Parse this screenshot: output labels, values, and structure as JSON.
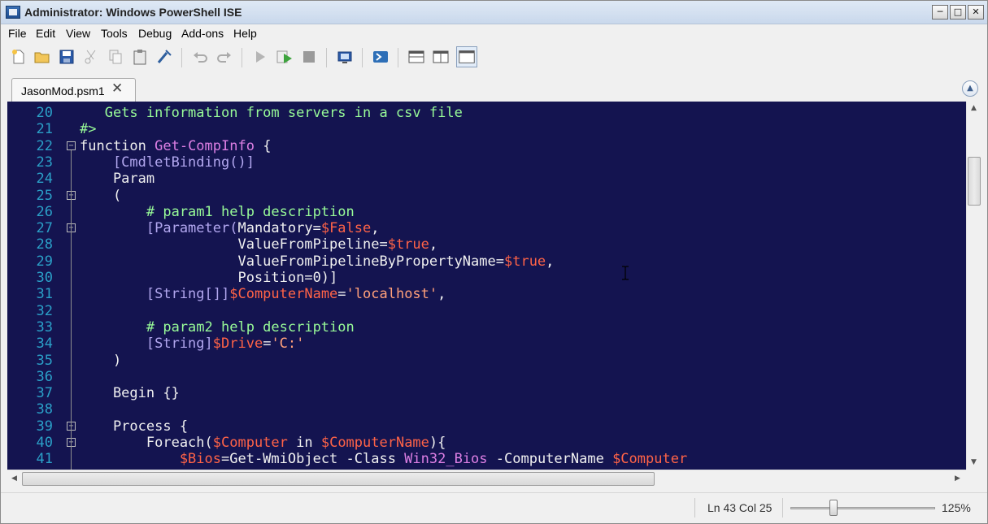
{
  "window": {
    "title": "Administrator: Windows PowerShell ISE"
  },
  "menu": [
    "File",
    "Edit",
    "View",
    "Tools",
    "Debug",
    "Add-ons",
    "Help"
  ],
  "toolbar": [
    "new-icon",
    "open-icon",
    "save-icon",
    "cut-icon",
    "copy-icon",
    "paste-icon",
    "clear-console-icon",
    "undo-icon",
    "redo-icon",
    "run-icon",
    "run-selection-icon",
    "stop-icon",
    "remote-powershell-icon",
    "powershell-icon",
    "show-script-top-icon",
    "show-script-right-icon",
    "show-script-maximized-icon"
  ],
  "tab": {
    "label": "JasonMod.psm1",
    "close": "✕"
  },
  "code_lines": [
    {
      "num": "20",
      "fold": "",
      "segs": [
        [
          "c-comment",
          "   Gets information from servers in a csv file"
        ]
      ]
    },
    {
      "num": "21",
      "fold": "",
      "segs": [
        [
          "c-comment",
          "#>"
        ]
      ]
    },
    {
      "num": "22",
      "fold": "⊟",
      "segs": [
        [
          "c-plain",
          "function "
        ],
        [
          "c-func",
          "Get-CompInfo"
        ],
        [
          "c-plain",
          " {"
        ]
      ]
    },
    {
      "num": "23",
      "fold": "",
      "segs": [
        [
          "c-type",
          "    [CmdletBinding()]"
        ]
      ]
    },
    {
      "num": "24",
      "fold": "",
      "segs": [
        [
          "c-plain",
          "    Param"
        ]
      ]
    },
    {
      "num": "25",
      "fold": "⊟",
      "segs": [
        [
          "c-plain",
          "    ("
        ]
      ]
    },
    {
      "num": "26",
      "fold": "",
      "segs": [
        [
          "c-comment",
          "        # param1 help description"
        ]
      ]
    },
    {
      "num": "27",
      "fold": "⊟",
      "segs": [
        [
          "c-type",
          "        [Parameter("
        ],
        [
          "c-plain",
          "Mandatory="
        ],
        [
          "c-var",
          "$False"
        ],
        [
          "c-plain",
          ","
        ]
      ]
    },
    {
      "num": "28",
      "fold": "",
      "segs": [
        [
          "c-plain",
          "                   ValueFromPipeline="
        ],
        [
          "c-var",
          "$true"
        ],
        [
          "c-plain",
          ","
        ]
      ]
    },
    {
      "num": "29",
      "fold": "",
      "segs": [
        [
          "c-plain",
          "                   ValueFromPipelineByPropertyName="
        ],
        [
          "c-var",
          "$true"
        ],
        [
          "c-plain",
          ","
        ]
      ]
    },
    {
      "num": "30",
      "fold": "",
      "segs": [
        [
          "c-plain",
          "                   Position=0)]"
        ]
      ]
    },
    {
      "num": "31",
      "fold": "",
      "segs": [
        [
          "c-type",
          "        [String[]]"
        ],
        [
          "c-var",
          "$ComputerName"
        ],
        [
          "c-plain",
          "="
        ],
        [
          "c-str",
          "'localhost'"
        ],
        [
          "c-plain",
          ","
        ]
      ]
    },
    {
      "num": "32",
      "fold": "",
      "segs": [
        [
          "c-plain",
          ""
        ]
      ]
    },
    {
      "num": "33",
      "fold": "",
      "segs": [
        [
          "c-comment",
          "        # param2 help description"
        ]
      ]
    },
    {
      "num": "34",
      "fold": "",
      "segs": [
        [
          "c-type",
          "        [String]"
        ],
        [
          "c-var",
          "$Drive"
        ],
        [
          "c-plain",
          "="
        ],
        [
          "c-str",
          "'C:'"
        ]
      ]
    },
    {
      "num": "35",
      "fold": "",
      "segs": [
        [
          "c-plain",
          "    )"
        ]
      ]
    },
    {
      "num": "36",
      "fold": "",
      "segs": [
        [
          "c-plain",
          ""
        ]
      ]
    },
    {
      "num": "37",
      "fold": "",
      "segs": [
        [
          "c-plain",
          "    Begin {}"
        ]
      ]
    },
    {
      "num": "38",
      "fold": "",
      "segs": [
        [
          "c-plain",
          ""
        ]
      ]
    },
    {
      "num": "39",
      "fold": "⊟",
      "segs": [
        [
          "c-plain",
          "    Process {"
        ]
      ]
    },
    {
      "num": "40",
      "fold": "⊟",
      "segs": [
        [
          "c-plain",
          "        Foreach("
        ],
        [
          "c-var",
          "$Computer"
        ],
        [
          "c-plain",
          " in "
        ],
        [
          "c-var",
          "$ComputerName"
        ],
        [
          "c-plain",
          "){"
        ]
      ]
    },
    {
      "num": "41",
      "fold": "",
      "segs": [
        [
          "c-var",
          "            $Bios"
        ],
        [
          "c-plain",
          "=Get-WmiObject -Class "
        ],
        [
          "c-func",
          "Win32_Bios"
        ],
        [
          "c-plain",
          " -ComputerName "
        ],
        [
          "c-var",
          "$Computer"
        ]
      ]
    }
  ],
  "status": {
    "position": "Ln 43  Col 25",
    "zoom": "125%",
    "zoom_level": 0.3
  },
  "colors": {
    "editor_bg": "#141450",
    "line_numbers": "#2ba0c8"
  }
}
